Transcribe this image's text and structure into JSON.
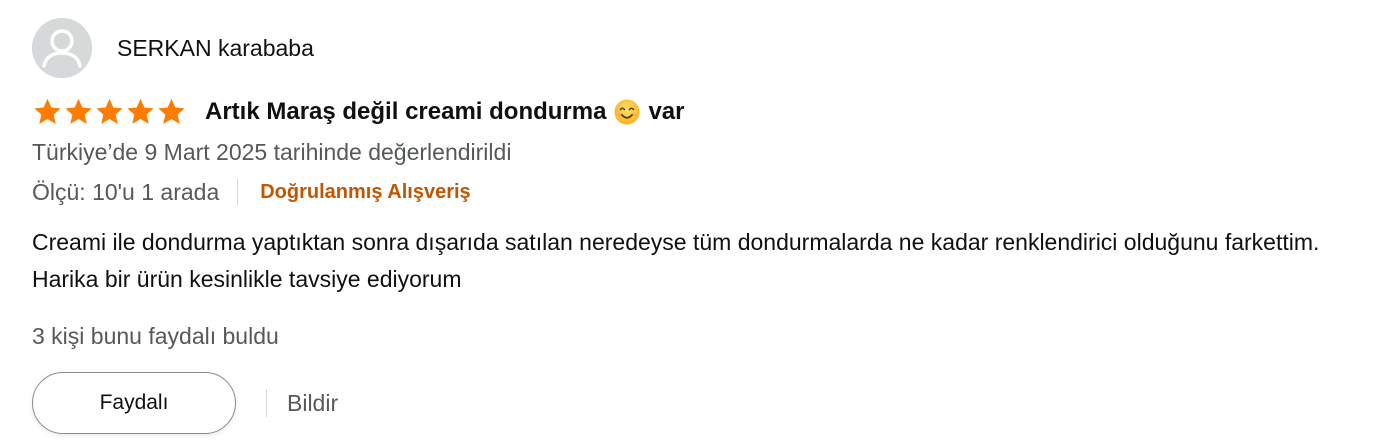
{
  "review": {
    "author": "SERKAN karababa",
    "rating": 5,
    "rating_max": 5,
    "star_color": "#ff7c00",
    "title_before_emoji": "Artık Maraş değil creami dondurma",
    "title_emoji": "smiling-face-emoji",
    "title_after_emoji": "var",
    "date": "Türkiye’de 9 Mart 2025 tarihinde değerlendirildi",
    "size": "Ölçü: 10'u 1 arada",
    "verified": "Doğrulanmış Alışveriş",
    "verified_color": "#c45500",
    "body": "Creami ile dondurma yaptıktan sonra dışarıda satılan neredeyse tüm dondurmalarda ne kadar renklendirici olduğunu farkettim. Harika bir ürün kesinlikle tavsiye ediyorum",
    "helpful_count": "3 kişi bunu faydalı buldu",
    "helpful_button": "Faydalı",
    "report_link": "Bildir"
  }
}
